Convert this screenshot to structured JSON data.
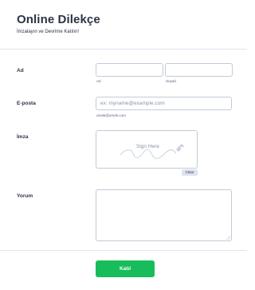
{
  "form": {
    "title": "Online Dilekçe",
    "subtitle": "İmzalayın ve Devrime Katılın!"
  },
  "name_field": {
    "label": "Ad",
    "first_sublabel": "Ad",
    "last_sublabel": "Soyad",
    "first_value": "",
    "last_value": ""
  },
  "email_field": {
    "label": "E-posta",
    "placeholder": "ex: myname@example.com",
    "sublabel": "ornek@ornek.com"
  },
  "signature_field": {
    "label": "İmza",
    "placeholder": "Sign Here",
    "clear_label": "Clear",
    "icon": "pen-icon"
  },
  "comment_field": {
    "label": "Yorum",
    "value": ""
  },
  "submit": {
    "label": "Katıl",
    "color": "#18bd5b"
  }
}
